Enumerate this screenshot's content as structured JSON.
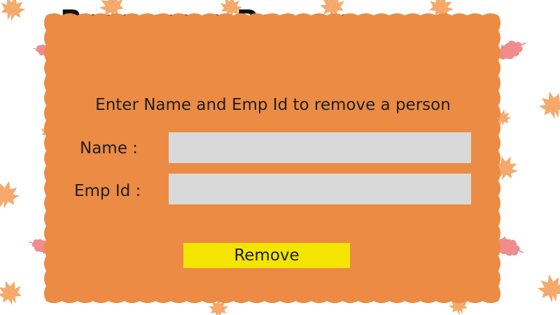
{
  "page": {
    "title": "Remove a Person",
    "instructions": "Enter Name and Emp Id to remove a person"
  },
  "form": {
    "name_label": "Name :",
    "name_value": "",
    "empid_label": "Emp Id :",
    "empid_value": "",
    "remove_label": "Remove"
  },
  "colors": {
    "card_background": "#ec8b43",
    "input_background": "#d9d9d9",
    "button_background": "#f4e500",
    "leaf_orange": "#f5a96a",
    "leaf_pink": "#f08c8c"
  },
  "decorations": {
    "background_pattern": "autumn-leaf-icon"
  }
}
